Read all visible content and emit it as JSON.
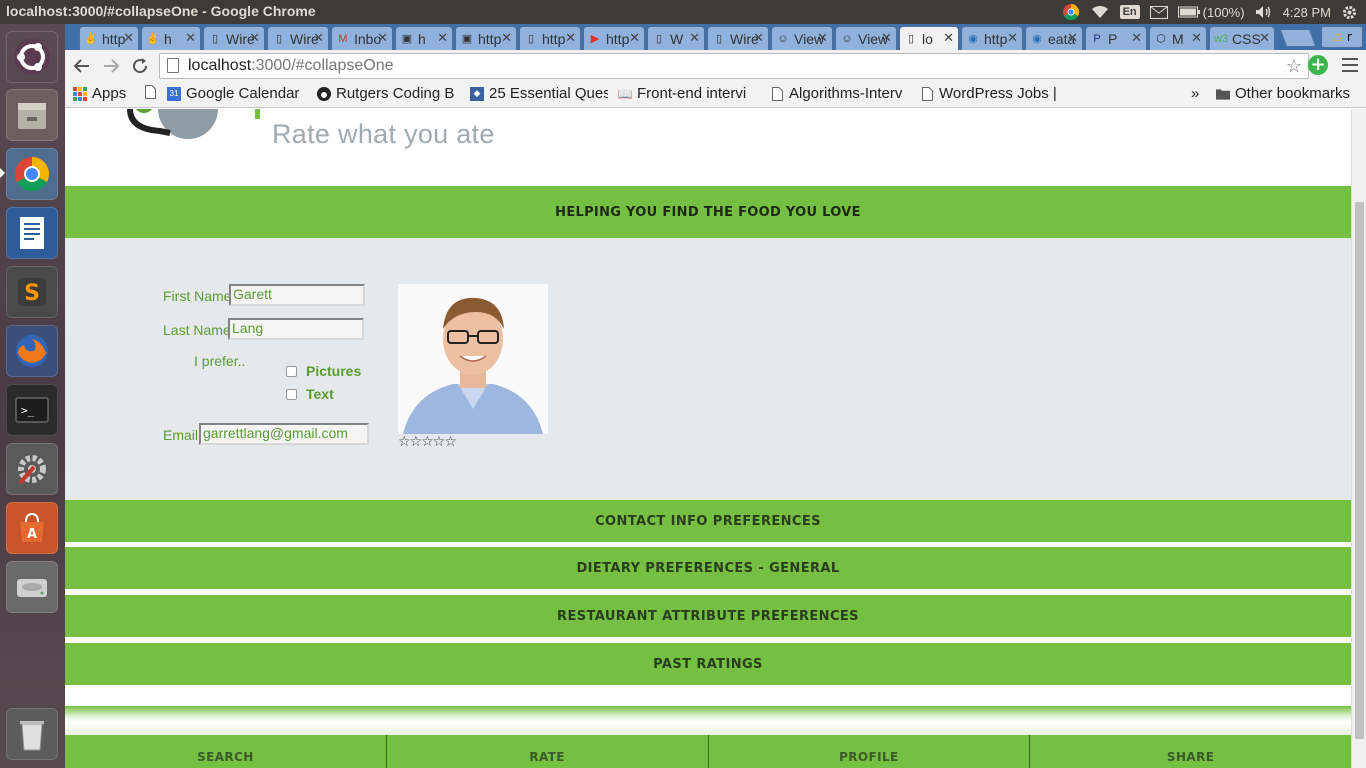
{
  "system": {
    "window_title": "localhost:3000/#collapseOne - Google Chrome",
    "keyboard_layout": "En",
    "battery": "(100%)",
    "clock": "4:28 PM"
  },
  "tabs": [
    {
      "label": "http",
      "icon": "peace-icon"
    },
    {
      "label": "h",
      "icon": "peace-icon"
    },
    {
      "label": "Wire",
      "icon": "page-icon"
    },
    {
      "label": "Wire",
      "icon": "page-icon"
    },
    {
      "label": "Inbo",
      "icon": "gmail-icon"
    },
    {
      "label": "h",
      "icon": "contact-icon"
    },
    {
      "label": "http",
      "icon": "contact-icon"
    },
    {
      "label": "http",
      "icon": "page-icon"
    },
    {
      "label": "http",
      "icon": "youtube-icon"
    },
    {
      "label": "W",
      "icon": "page-icon"
    },
    {
      "label": "Wire",
      "icon": "page-icon"
    },
    {
      "label": "View",
      "icon": "smiley-icon"
    },
    {
      "label": "View",
      "icon": "smiley-icon"
    },
    {
      "label": "lo",
      "icon": "page-icon",
      "active": true
    },
    {
      "label": "http",
      "icon": "eye-icon"
    },
    {
      "label": "eata",
      "icon": "eye-icon"
    },
    {
      "label": "P",
      "icon": "p-icon"
    },
    {
      "label": "M",
      "icon": "codepen-icon"
    },
    {
      "label": "CSS",
      "icon": "w3-icon"
    }
  ],
  "address_bar": {
    "host": "localhost",
    "path": ":3000/#collapseOne"
  },
  "bookmarks": [
    {
      "label": "Apps",
      "icon": "apps-icon"
    },
    {
      "label": "",
      "icon": "page-icon"
    },
    {
      "label": "Google Calendar",
      "icon": "calendar-icon"
    },
    {
      "label": "Rutgers Coding B",
      "icon": "github-icon"
    },
    {
      "label": "25 Essential Ques",
      "icon": "toptal-icon"
    },
    {
      "label": "Front-end intervi",
      "icon": "book-icon"
    },
    {
      "label": "Algorithms-Interv",
      "icon": "page-icon"
    },
    {
      "label": "WordPress Jobs |",
      "icon": "page-icon"
    }
  ],
  "bookmarks_overflow": "»",
  "other_bookmarks": "Other bookmarks",
  "page": {
    "tagline": "Rate what you ate",
    "hero": "HELPING YOU FIND THE FOOD YOU LOVE",
    "form": {
      "first_name_label": "First Name",
      "first_name_value": "Garett",
      "last_name_label": "Last Name",
      "last_name_value": "Lang",
      "prefer_label": "I prefer..",
      "opt_pictures": "Pictures",
      "opt_text": "Text",
      "email_label": "Email",
      "email_value": "garrettlang@gmail.com"
    },
    "rating_stars": "☆☆☆☆☆",
    "accordions": [
      "CONTACT INFO PREFERENCES",
      "DIETARY PREFERENCES - GENERAL",
      "RESTAURANT ATTRIBUTE PREFERENCES",
      "PAST RATINGS"
    ],
    "bottom_nav": [
      "SEARCH",
      "RATE",
      "PROFILE",
      "SHARE"
    ]
  },
  "colors": {
    "brand_green": "#75c043",
    "label_green": "#5a9c32",
    "panel_gray": "#e6e9ec"
  }
}
